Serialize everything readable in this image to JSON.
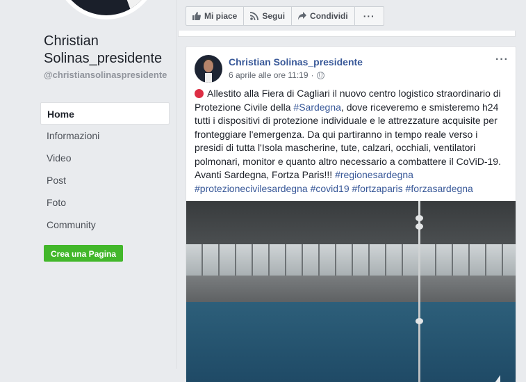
{
  "sidebar": {
    "page_name": "Christian Solinas_presidente",
    "handle": "@christiansolinaspresidente",
    "nav": [
      {
        "label": "Home",
        "active": true
      },
      {
        "label": "Informazioni",
        "active": false
      },
      {
        "label": "Video",
        "active": false
      },
      {
        "label": "Post",
        "active": false
      },
      {
        "label": "Foto",
        "active": false
      },
      {
        "label": "Community",
        "active": false
      }
    ],
    "create_page_label": "Crea una Pagina"
  },
  "actionbar": {
    "like_label": "Mi piace",
    "follow_label": "Segui",
    "share_label": "Condividi",
    "more_label": "···"
  },
  "post": {
    "author": "Christian Solinas_presidente",
    "timestamp": "6 aprile alle ore 11:19",
    "separator": "·",
    "options_label": "···",
    "text_parts": {
      "p1": " Allestito alla Fiera di Cagliari il nuovo centro logistico straordinario di Protezione Civile della ",
      "tag1": "#Sardegna",
      "p2": ", dove riceveremo e smisteremo h24 tutti i dispositivi di protezione individuale e le attrezzature acquisite per fronteggiare l'emergenza. Da qui partiranno in tempo reale verso i presidi di tutta l'Isola mascherine, tute, calzari, occhiali, ventilatori polmonari, monitor e quanto altro necessario a combattere il CoViD-19. Avanti Sardegna, Fortza Paris!!! ",
      "tag2": "#regionesardegna",
      "tag3": "#protezionecivilesardegna",
      "tag4": "#covid19",
      "tag5": "#fortzaparis",
      "tag6": "#forzasardegna"
    }
  },
  "colors": {
    "link": "#385898",
    "create_button": "#42b72a",
    "alert_dot": "#dd2e44"
  }
}
